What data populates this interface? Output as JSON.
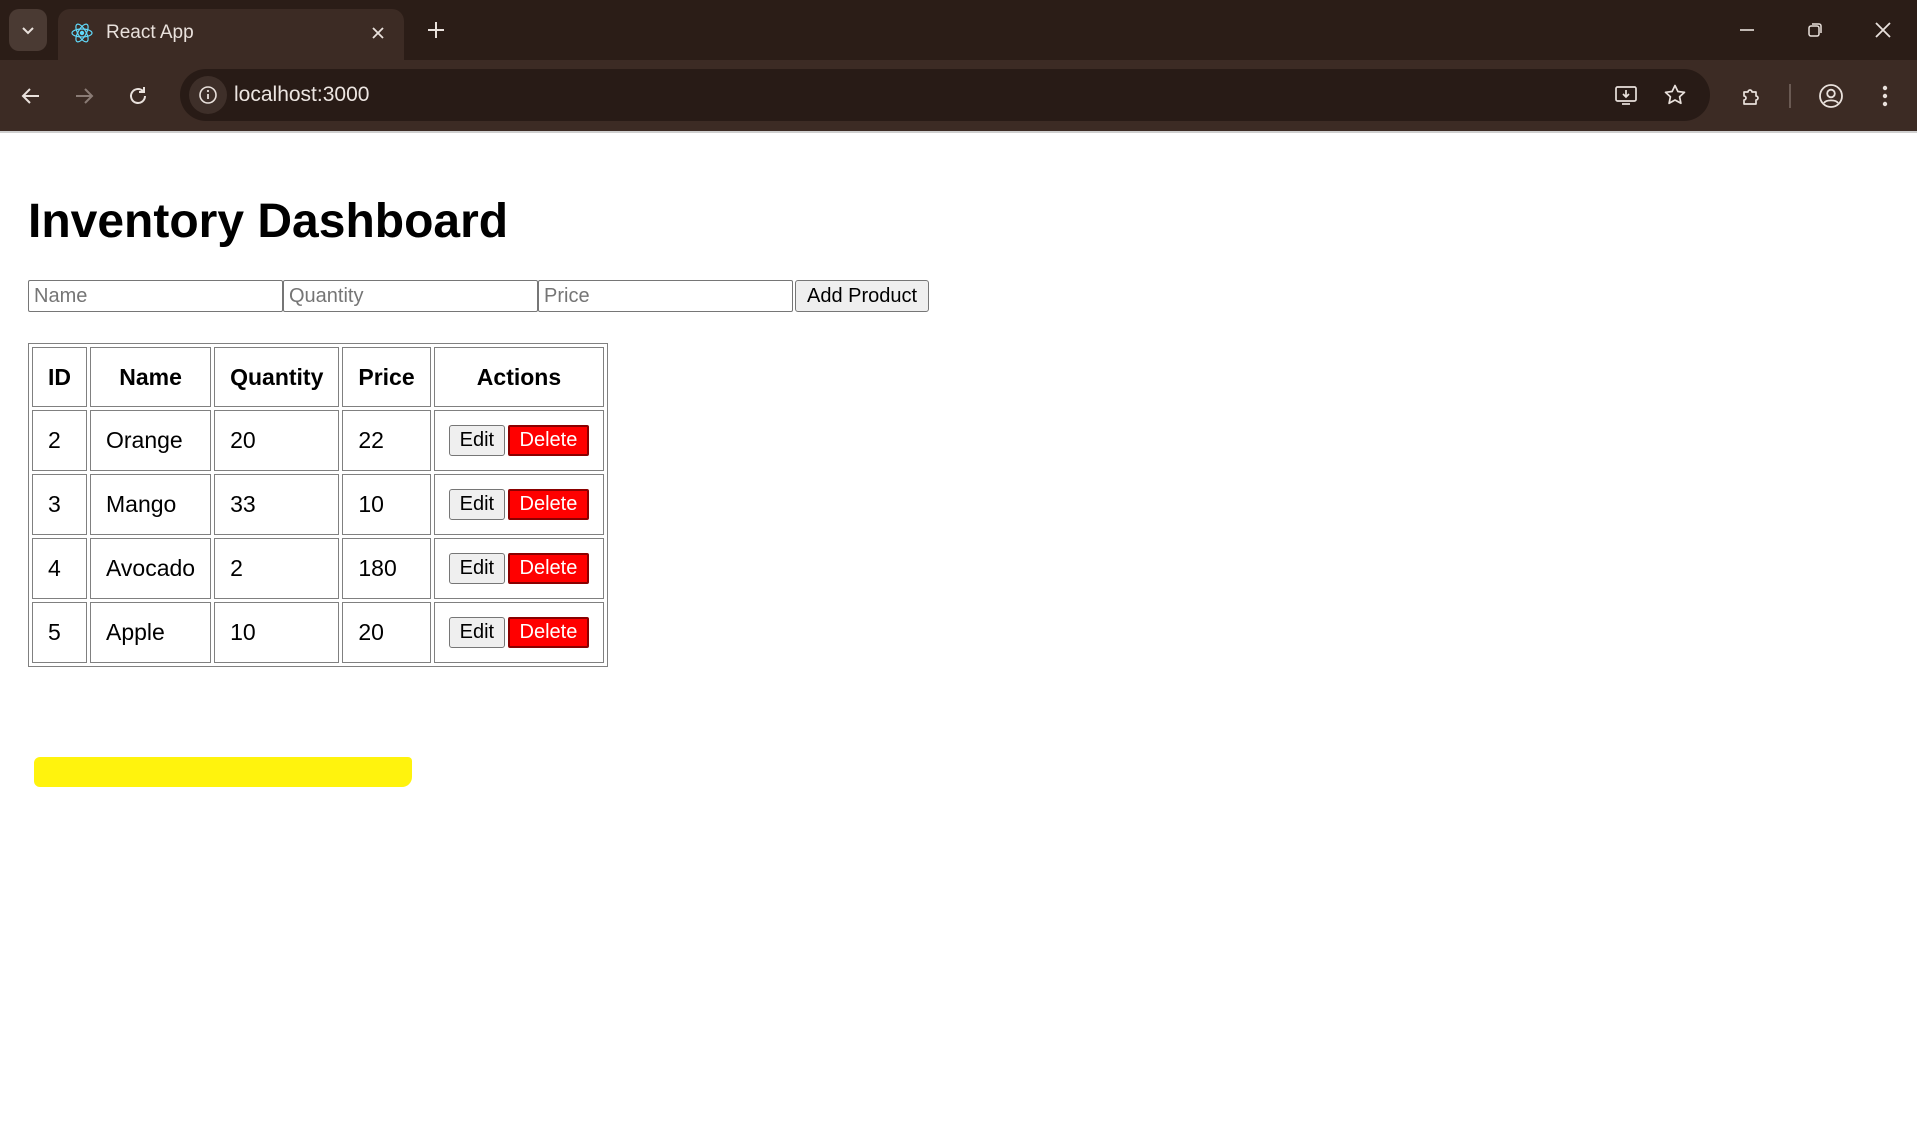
{
  "browser": {
    "tab_title": "React App",
    "url": "localhost:3000",
    "icons": {
      "tab_search": "chevron-down-icon",
      "favicon": "react-icon",
      "tab_close": "close-icon",
      "new_tab": "plus-icon",
      "minimize": "minimize-icon",
      "restore": "restore-icon",
      "close_window": "close-icon",
      "back": "back-arrow-icon",
      "forward": "forward-arrow-icon",
      "reload": "reload-icon",
      "site_info": "info-icon",
      "install": "install-app-icon",
      "bookmark": "star-icon",
      "extensions": "puzzle-icon",
      "profile": "profile-icon",
      "menu": "kebab-menu-icon"
    }
  },
  "page": {
    "title": "Inventory Dashboard",
    "form": {
      "name_placeholder": "Name",
      "quantity_placeholder": "Quantity",
      "price_placeholder": "Price",
      "add_button": "Add Product"
    },
    "table": {
      "headers": [
        "ID",
        "Name",
        "Quantity",
        "Price",
        "Actions"
      ],
      "edit_label": "Edit",
      "delete_label": "Delete",
      "rows": [
        {
          "id": "2",
          "name": "Orange",
          "quantity": "20",
          "price": "22"
        },
        {
          "id": "3",
          "name": "Mango",
          "quantity": "33",
          "price": "10"
        },
        {
          "id": "4",
          "name": "Avocado",
          "quantity": "2",
          "price": "180"
        },
        {
          "id": "5",
          "name": "Apple",
          "quantity": "10",
          "price": "20"
        }
      ]
    },
    "colors": {
      "delete_bg": "#ff0000",
      "highlight": "#fff200",
      "chrome_bg": "#2b1d17"
    }
  }
}
